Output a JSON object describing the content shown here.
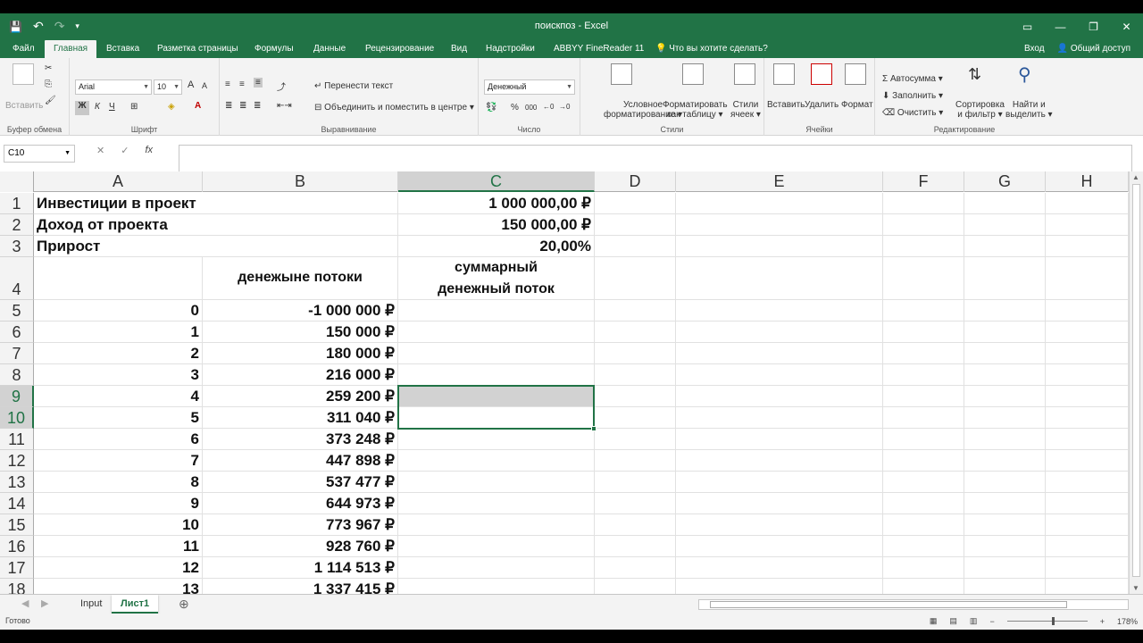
{
  "window": {
    "title": "поискпоз - Excel",
    "min": "—",
    "restore": "❐",
    "close": "✕",
    "ribbon_opts": "▭"
  },
  "qat": {
    "save": "💾",
    "undo": "↶",
    "redo": "↷",
    "more": "▾"
  },
  "tabs": [
    "Файл",
    "Главная",
    "Вставка",
    "Разметка страницы",
    "Формулы",
    "Данные",
    "Рецензирование",
    "Вид",
    "Надстройки",
    "ABBYY FineReader 11"
  ],
  "active_tab": "Главная",
  "tellme": "Что вы хотите сделать?",
  "signin": "Вход",
  "share": "Общий доступ",
  "ribbon": {
    "clipboard": {
      "paste": "Вставить",
      "label": "Буфер обмена"
    },
    "font": {
      "name": "Arial",
      "size": "10",
      "bold": "Ж",
      "italic": "К",
      "underline": "Ч",
      "grow": "A",
      "shrink": "A",
      "label": "Шрифт"
    },
    "align": {
      "wrap": "Перенести текст",
      "merge": "Объединить и поместить в центре",
      "label": "Выравнивание"
    },
    "number": {
      "format": "Денежный",
      "percent": "%",
      "thousands": "000",
      "label": "Число"
    },
    "styles": {
      "conditional1": "Условное",
      "conditional2": "форматирование",
      "table1": "Форматировать",
      "table2": "как таблицу",
      "cell1": "Стили",
      "cell2": "ячеек",
      "label": "Стили"
    },
    "cells": {
      "insert": "Вставить",
      "delete": "Удалить",
      "format": "Формат",
      "label": "Ячейки"
    },
    "editing": {
      "autosum": "Автосумма",
      "fill": "Заполнить",
      "clear": "Очистить",
      "sort1": "Сортировка",
      "sort2": "и фильтр",
      "find1": "Найти и",
      "find2": "выделить",
      "label": "Редактирование"
    }
  },
  "namebox": "C10",
  "formula": "",
  "formula_icons": {
    "cancel": "✕",
    "enter": "✓",
    "fx": "fx"
  },
  "columns": [
    "A",
    "B",
    "C",
    "D",
    "E",
    "F",
    "G",
    "H"
  ],
  "selected_column": "C",
  "rows": [
    {
      "n": "1",
      "a": "Инвестиции в проект",
      "b": "",
      "c": "1 000 000,00 ₽"
    },
    {
      "n": "2",
      "a": "Доход от проекта",
      "b": "",
      "c": "150 000,00 ₽"
    },
    {
      "n": "3",
      "a": "Прирост",
      "b": "",
      "c": "20,00%"
    },
    {
      "n": "4",
      "a": "",
      "b": "денежыне потоки",
      "c": "суммарный денежный поток"
    },
    {
      "n": "5",
      "a": "0",
      "b": "-1 000 000 ₽",
      "c": ""
    },
    {
      "n": "6",
      "a": "1",
      "b": "150 000 ₽",
      "c": ""
    },
    {
      "n": "7",
      "a": "2",
      "b": "180 000 ₽",
      "c": ""
    },
    {
      "n": "8",
      "a": "3",
      "b": "216 000 ₽",
      "c": ""
    },
    {
      "n": "9",
      "a": "4",
      "b": "259 200 ₽",
      "c": ""
    },
    {
      "n": "10",
      "a": "5",
      "b": "311 040 ₽",
      "c": ""
    },
    {
      "n": "11",
      "a": "6",
      "b": "373 248 ₽",
      "c": ""
    },
    {
      "n": "12",
      "a": "7",
      "b": "447 898 ₽",
      "c": ""
    },
    {
      "n": "13",
      "a": "8",
      "b": "537 477 ₽",
      "c": ""
    },
    {
      "n": "14",
      "a": "9",
      "b": "644 973 ₽",
      "c": ""
    },
    {
      "n": "15",
      "a": "10",
      "b": "773 967 ₽",
      "c": ""
    },
    {
      "n": "16",
      "a": "11",
      "b": "928 760 ₽",
      "c": ""
    },
    {
      "n": "17",
      "a": "12",
      "b": "1 114 513 ₽",
      "c": ""
    },
    {
      "n": "18",
      "a": "13",
      "b": "1 337 415 ₽",
      "c": ""
    }
  ],
  "selected_rows": [
    "9",
    "10"
  ],
  "sheets": [
    "Input",
    "Лист1"
  ],
  "active_sheet": "Лист1",
  "add_sheet": "⊕",
  "status": {
    "ready": "Готово",
    "zoom": "178%",
    "minus": "−",
    "plus": "+"
  }
}
